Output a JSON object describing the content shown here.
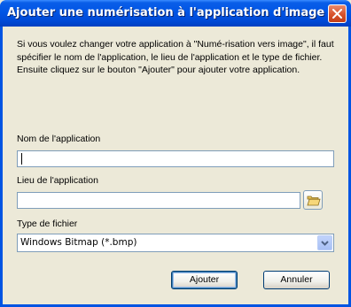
{
  "window": {
    "title": "Ajouter une numérisation à l'application d'image"
  },
  "description": "Si vous voulez changer votre application à \"Numé-risation vers image\", il faut spécifier le nom de l'application, le lieu de l'application et le type de fichier. Ensuite cliquez sur le bouton \"Ajouter\" pour ajouter votre application.",
  "fields": {
    "app_name_label": "Nom de l'application",
    "app_name_value": "",
    "app_path_label": "Lieu de l'application",
    "app_path_value": "",
    "file_type_label": "Type de fichier",
    "file_type_value": "Windows Bitmap (*.bmp)"
  },
  "buttons": {
    "add": "Ajouter",
    "cancel": "Annuler"
  },
  "icons": {
    "close": "close-icon",
    "browse": "folder-icon",
    "dropdown": "chevron-down-icon"
  }
}
